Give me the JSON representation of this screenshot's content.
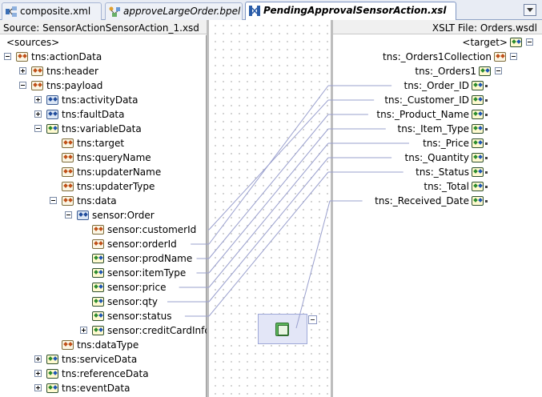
{
  "tabs": [
    {
      "label": "composite.xml",
      "icon": "composite-icon",
      "active": false
    },
    {
      "label": "approveLargeOrder.bpel",
      "icon": "bpel-icon",
      "active": false
    },
    {
      "label": "PendingApprovalSensorAction.xsl",
      "icon": "xsl-icon",
      "active": true
    }
  ],
  "source_header": "Source: SensorActionSensorAction_1.xsd",
  "xslt_header": "XSLT File: Orders.wsdl",
  "source_tree": [
    {
      "label": "<sources>",
      "depth": 0,
      "toggle": "none",
      "icon": "none"
    },
    {
      "label": "tns:actionData",
      "depth": 0,
      "toggle": "minus",
      "icon": "element"
    },
    {
      "label": "tns:header",
      "depth": 1,
      "toggle": "plus",
      "icon": "element"
    },
    {
      "label": "tns:payload",
      "depth": 1,
      "toggle": "minus",
      "icon": "element"
    },
    {
      "label": "tns:activityData",
      "depth": 2,
      "toggle": "plus",
      "icon": "complex"
    },
    {
      "label": "tns:faultData",
      "depth": 2,
      "toggle": "plus",
      "icon": "complex"
    },
    {
      "label": "tns:variableData",
      "depth": 2,
      "toggle": "minus",
      "icon": "complex2"
    },
    {
      "label": "tns:target",
      "depth": 3,
      "toggle": "none",
      "icon": "element"
    },
    {
      "label": "tns:queryName",
      "depth": 3,
      "toggle": "none",
      "icon": "element"
    },
    {
      "label": "tns:updaterName",
      "depth": 3,
      "toggle": "none",
      "icon": "element"
    },
    {
      "label": "tns:updaterType",
      "depth": 3,
      "toggle": "none",
      "icon": "element"
    },
    {
      "label": "tns:data",
      "depth": 3,
      "toggle": "minus",
      "icon": "element"
    },
    {
      "label": "sensor:Order",
      "depth": 4,
      "toggle": "minus",
      "icon": "complex"
    },
    {
      "label": "sensor:customerId",
      "depth": 5,
      "toggle": "none",
      "icon": "element"
    },
    {
      "label": "sensor:orderId",
      "depth": 5,
      "toggle": "none",
      "icon": "element"
    },
    {
      "label": "sensor:prodName",
      "depth": 5,
      "toggle": "none",
      "icon": "complex2"
    },
    {
      "label": "sensor:itemType",
      "depth": 5,
      "toggle": "none",
      "icon": "complex2"
    },
    {
      "label": "sensor:price",
      "depth": 5,
      "toggle": "none",
      "icon": "complex2"
    },
    {
      "label": "sensor:qty",
      "depth": 5,
      "toggle": "none",
      "icon": "complex2"
    },
    {
      "label": "sensor:status",
      "depth": 5,
      "toggle": "none",
      "icon": "complex2"
    },
    {
      "label": "sensor:creditCardInfo",
      "depth": 5,
      "toggle": "plus",
      "icon": "complex2"
    },
    {
      "label": "tns:dataType",
      "depth": 3,
      "toggle": "none",
      "icon": "element"
    },
    {
      "label": "tns:serviceData",
      "depth": 2,
      "toggle": "plus",
      "icon": "complex2"
    },
    {
      "label": "tns:referenceData",
      "depth": 2,
      "toggle": "plus",
      "icon": "complex2"
    },
    {
      "label": "tns:eventData",
      "depth": 2,
      "toggle": "plus",
      "icon": "complex2"
    }
  ],
  "target_tree": [
    {
      "label": "<target>",
      "depth": 0,
      "toggle": "minus",
      "icon": "target"
    },
    {
      "label": "tns:_Orders1Collection",
      "depth": 1,
      "toggle": "minus",
      "icon": "element"
    },
    {
      "label": "tns:_Orders1",
      "depth": 2,
      "toggle": "minus",
      "icon": "complex2"
    },
    {
      "label": "tns:_Order_ID",
      "depth": 3,
      "toggle": "none",
      "icon": "complex2"
    },
    {
      "label": "tns:_Customer_ID",
      "depth": 3,
      "toggle": "none",
      "icon": "complex2"
    },
    {
      "label": "tns:_Product_Name",
      "depth": 3,
      "toggle": "none",
      "icon": "complex2"
    },
    {
      "label": "tns:_Item_Type",
      "depth": 3,
      "toggle": "none",
      "icon": "complex2"
    },
    {
      "label": "tns:_Price",
      "depth": 3,
      "toggle": "none",
      "icon": "complex2"
    },
    {
      "label": "tns:_Quantity",
      "depth": 3,
      "toggle": "none",
      "icon": "complex2"
    },
    {
      "label": "tns:_Status",
      "depth": 3,
      "toggle": "none",
      "icon": "complex2"
    },
    {
      "label": "tns:_Total",
      "depth": 3,
      "toggle": "none",
      "icon": "complex2"
    },
    {
      "label": "tns:_Received_Date",
      "depth": 3,
      "toggle": "none",
      "icon": "complex2"
    }
  ],
  "mappings": [
    {
      "source": "sensor:customerId",
      "target": "tns:_Customer_ID"
    },
    {
      "source": "sensor:orderId",
      "target": "tns:_Order_ID"
    },
    {
      "source": "sensor:prodName",
      "target": "tns:_Product_Name"
    },
    {
      "source": "sensor:itemType",
      "target": "tns:_Item_Type"
    },
    {
      "source": "sensor:price",
      "target": "tns:_Price"
    },
    {
      "source": "sensor:qty",
      "target": "tns:_Quantity"
    },
    {
      "source": "sensor:status",
      "target": "tns:_Status"
    },
    {
      "source": "function",
      "target": "tns:_Received_Date"
    }
  ],
  "colors": {
    "link": "#9aa0ce",
    "function_box": "#e3e6f7",
    "accent": "#214c9c"
  }
}
